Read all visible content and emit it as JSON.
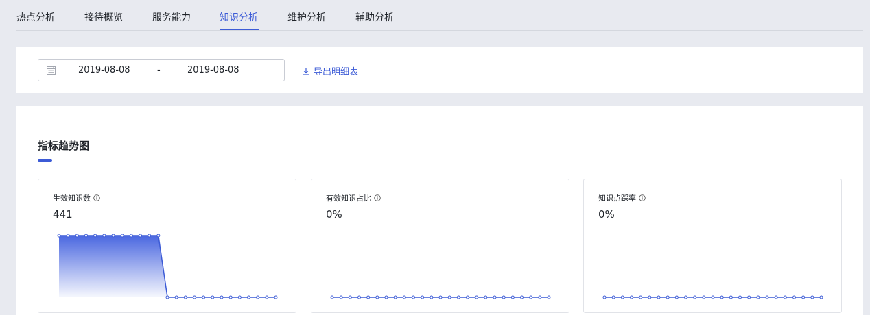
{
  "tabs": [
    {
      "label": "热点分析",
      "active": false
    },
    {
      "label": "接待概览",
      "active": false
    },
    {
      "label": "服务能力",
      "active": false
    },
    {
      "label": "知识分析",
      "active": true
    },
    {
      "label": "维护分析",
      "active": false
    },
    {
      "label": "辅助分析",
      "active": false
    }
  ],
  "filter": {
    "start_date": "2019-08-08",
    "separator": "-",
    "end_date": "2019-08-08",
    "calendar_icon": "calendar-icon",
    "export_label": "导出明细表",
    "export_icon": "download-icon"
  },
  "section": {
    "title": "指标趋势图"
  },
  "colors": {
    "accent": "#3c5bd6",
    "area_top": "#4a67e0",
    "text": "#1f2329"
  },
  "metrics": [
    {
      "label": "生效知识数",
      "value": "441",
      "info_icon": "info-icon",
      "chart_data": {
        "type": "area",
        "values": [
          441,
          441,
          441,
          441,
          441,
          441,
          441,
          441,
          441,
          441,
          441,
          441,
          0,
          0,
          0,
          0,
          0,
          0,
          0,
          0,
          0,
          0,
          0,
          0,
          0
        ],
        "ylim": [
          0,
          441
        ]
      }
    },
    {
      "label": "有效知识占比",
      "value": "0%",
      "info_icon": "info-icon",
      "chart_data": {
        "type": "line",
        "values": [
          0,
          0,
          0,
          0,
          0,
          0,
          0,
          0,
          0,
          0,
          0,
          0,
          0,
          0,
          0,
          0,
          0,
          0,
          0,
          0,
          0,
          0,
          0,
          0,
          0
        ],
        "ylim": [
          0,
          1
        ]
      }
    },
    {
      "label": "知识点踩率",
      "value": "0%",
      "info_icon": "info-icon",
      "chart_data": {
        "type": "line",
        "values": [
          0,
          0,
          0,
          0,
          0,
          0,
          0,
          0,
          0,
          0,
          0,
          0,
          0,
          0,
          0,
          0,
          0,
          0,
          0,
          0,
          0,
          0,
          0,
          0,
          0
        ],
        "ylim": [
          0,
          1
        ]
      }
    }
  ]
}
